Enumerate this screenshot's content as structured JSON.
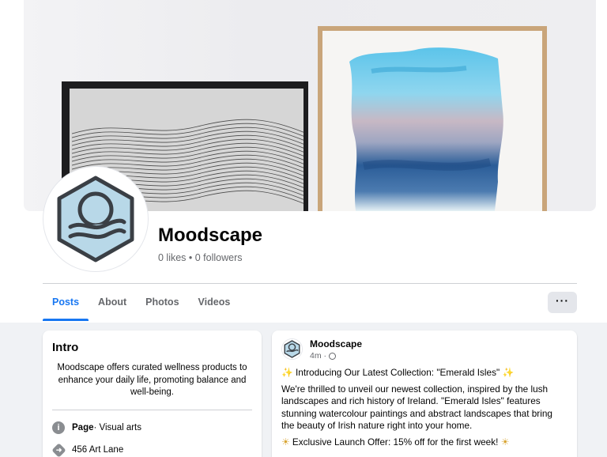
{
  "page": {
    "name": "Moodscape",
    "stats": "0 likes • 0 followers"
  },
  "tabs": [
    {
      "label": "Posts",
      "active": true
    },
    {
      "label": "About",
      "active": false
    },
    {
      "label": "Photos",
      "active": false
    },
    {
      "label": "Videos",
      "active": false
    }
  ],
  "more_label": "···",
  "intro": {
    "title": "Intro",
    "bio": "Moodscape offers curated wellness products to enhance your daily life, promoting balance and well-being.",
    "page_label": "Page",
    "category": " · Visual arts",
    "address": "456 Art Lane"
  },
  "post": {
    "author": "Moodscape",
    "time": "4m ·",
    "line1": "Introducing Our Latest Collection: \"Emerald Isles\"",
    "body": "We're thrilled to unveil our newest collection, inspired by the lush landscapes and rich history of Ireland. \"Emerald Isles\" features stunning watercolour paintings and abstract landscapes that bring the beauty of Irish nature right into your home.",
    "offer": "Exclusive Launch Offer: 15% off for the first week!"
  },
  "colors": {
    "accent": "#1877f2",
    "logo_fill": "#b8d8e8",
    "logo_stroke": "#3a3f45"
  },
  "icons": {
    "info": "info-icon",
    "directions": "directions-icon",
    "globe": "globe-icon",
    "sparkle": "sparkle-icon",
    "sun": "sun-icon"
  }
}
